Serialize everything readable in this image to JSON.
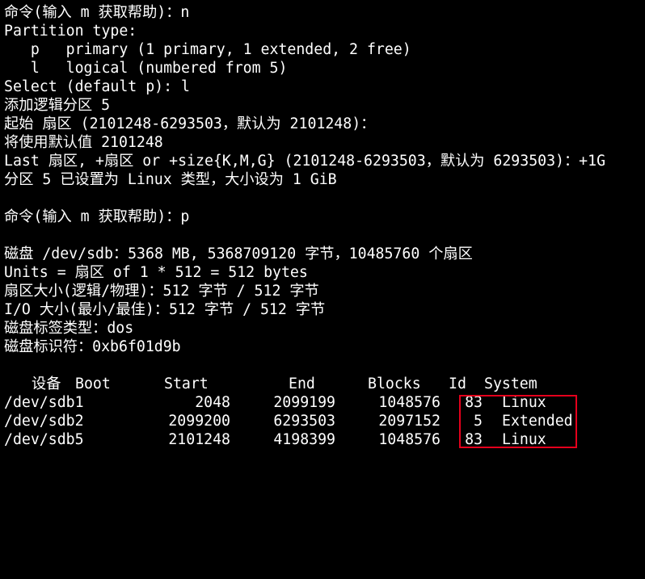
{
  "terminal": {
    "lines": [
      "命令(输入 m 获取帮助)：n",
      "Partition type:",
      "   p   primary (1 primary, 1 extended, 2 free)",
      "   l   logical (numbered from 5)",
      "Select (default p): l",
      "添加逻辑分区 5",
      "起始 扇区 (2101248-6293503，默认为 2101248)：",
      "将使用默认值 2101248",
      "Last 扇区, +扇区 or +size{K,M,G} (2101248-6293503，默认为 6293503)：+1G",
      "分区 5 已设置为 Linux 类型，大小设为 1 GiB",
      "",
      "命令(输入 m 获取帮助)：p",
      "",
      "磁盘 /dev/sdb：5368 MB, 5368709120 字节，10485760 个扇区",
      "Units = 扇区 of 1 * 512 = 512 bytes",
      "扇区大小(逻辑/物理)：512 字节 / 512 字节",
      "I/O 大小(最小/最佳)：512 字节 / 512 字节",
      "磁盘标签类型：dos",
      "磁盘标识符：0xb6f01d9b",
      ""
    ]
  },
  "partition_table": {
    "headers": {
      "device": "设备",
      "boot": "Boot",
      "start": "Start",
      "end": "End",
      "blocks": "Blocks",
      "id": "Id",
      "system": "System"
    },
    "rows": [
      {
        "device": "/dev/sdb1",
        "start": "2048",
        "end": "2099199",
        "blocks": "1048576",
        "id": "83",
        "system": "Linux"
      },
      {
        "device": "/dev/sdb2",
        "start": "2099200",
        "end": "6293503",
        "blocks": "2097152",
        "id": "5",
        "system": "Extended"
      },
      {
        "device": "/dev/sdb5",
        "start": "2101248",
        "end": "4198399",
        "blocks": "1048576",
        "id": "83",
        "system": "Linux"
      }
    ]
  },
  "colors": {
    "background": "#000000",
    "text": "#ffffff",
    "highlight_box": "#e5001c"
  }
}
